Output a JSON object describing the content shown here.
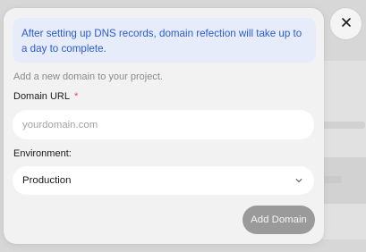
{
  "modal": {
    "info_banner": "After setting up DNS records, domain refection will take up to a day to complete.",
    "description": "Add a new domain to your project.",
    "domain_label": "Domain URL",
    "required_mark": "*",
    "domain_input": {
      "value": "",
      "placeholder": "yourdomain.com"
    },
    "environment_label": "Environment:",
    "environment_select": {
      "selected": "Production"
    },
    "add_button_label": "Add Domain"
  },
  "icons": {
    "close": "close-icon",
    "dropdown": "chevron-down-icon"
  },
  "colors": {
    "info_text": "#2d5bd7",
    "info_background": "#e6ecf9",
    "required": "#e5484d",
    "button_disabled": "#9a9a9a"
  }
}
